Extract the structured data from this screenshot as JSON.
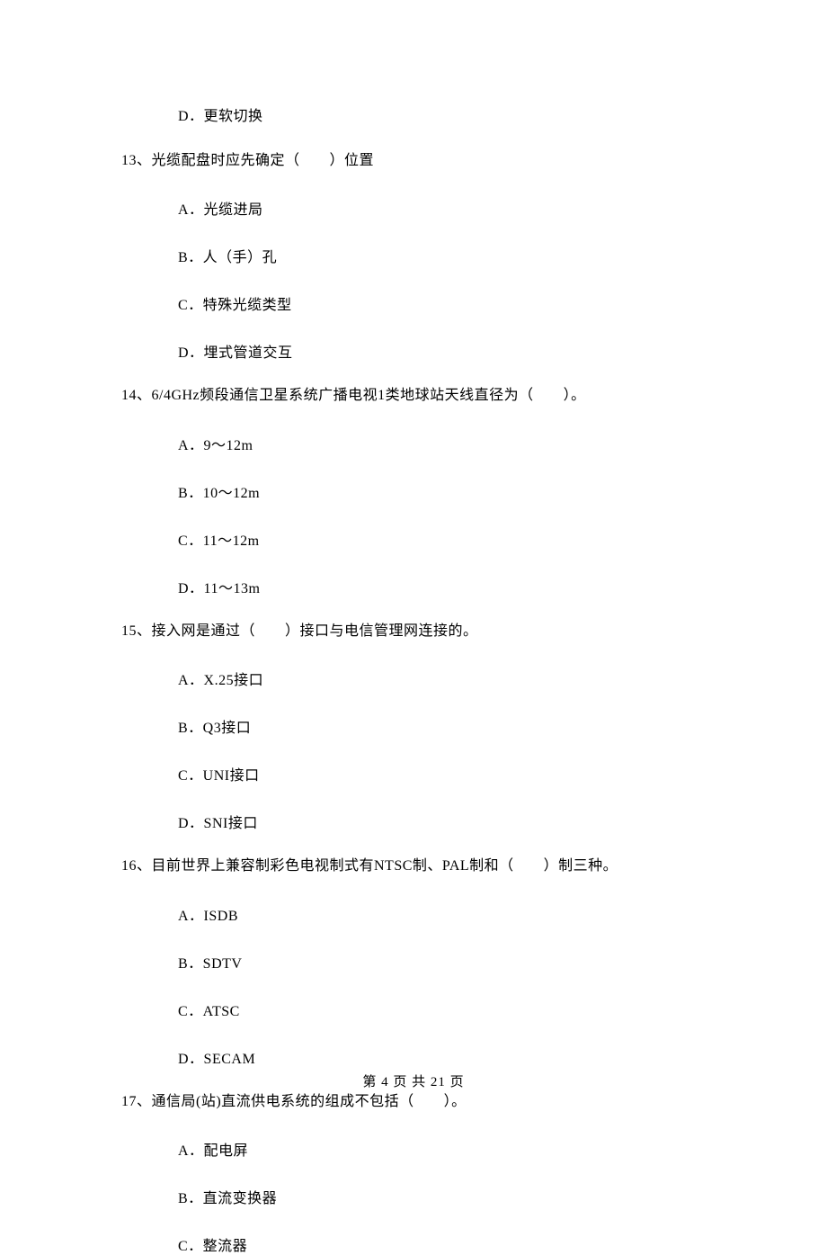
{
  "solo_option": "D．更软切换",
  "q13": {
    "text": "13、光缆配盘时应先确定（　　）位置",
    "a": "A．光缆进局",
    "b": "B．人（手）孔",
    "c": "C．特殊光缆类型",
    "d": "D．埋式管道交互"
  },
  "q14": {
    "text": "14、6/4GHz频段通信卫星系统广播电视1类地球站天线直径为（　　）。",
    "a": "A．9～12m",
    "b": "B．10～12m",
    "c": "C．11～12m",
    "d": "D．11～13m"
  },
  "q15": {
    "text": "15、接入网是通过（　　）接口与电信管理网连接的。",
    "a": "A．X.25接口",
    "b": "B．Q3接口",
    "c": "C．UNI接口",
    "d": "D．SNI接口"
  },
  "q16": {
    "text": "16、目前世界上兼容制彩色电视制式有NTSC制、PAL制和（　　）制三种。",
    "a": "A．ISDB",
    "b": "B．SDTV",
    "c": "C．ATSC",
    "d": "D．SECAM"
  },
  "q17": {
    "text": "17、通信局(站)直流供电系统的组成不包括（　　）。",
    "a": "A．配电屏",
    "b": "B．直流变换器",
    "c": "C．整流器"
  },
  "footer": "第 4 页 共 21 页"
}
